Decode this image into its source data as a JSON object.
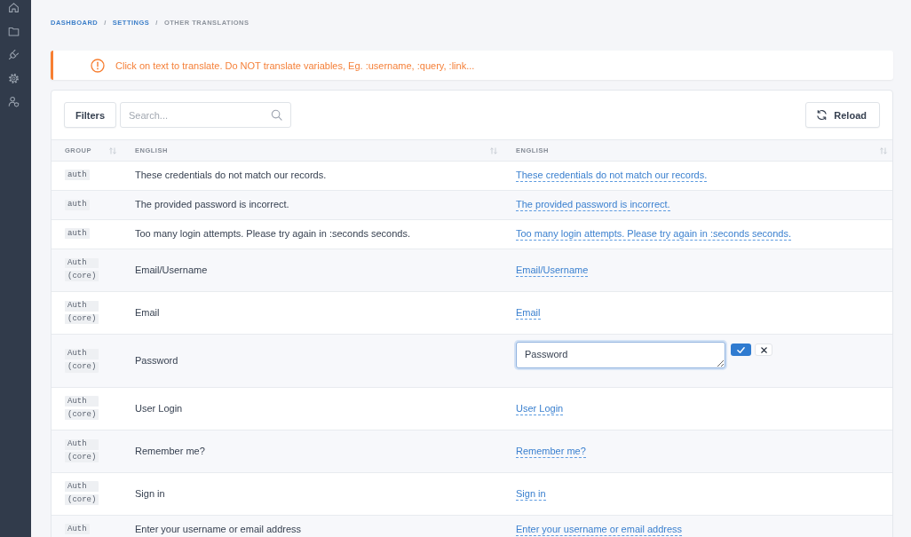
{
  "breadcrumb": [
    {
      "label": "DASHBOARD",
      "kind": "link"
    },
    {
      "label": "/",
      "kind": "separator"
    },
    {
      "label": "SETTINGS",
      "kind": "link"
    },
    {
      "label": "/",
      "kind": "separator"
    },
    {
      "label": "OTHER TRANSLATIONS",
      "kind": "current"
    }
  ],
  "alert": {
    "message": "Click on text to translate. Do NOT translate variables, Eg. :username, :query, :link..."
  },
  "toolbar": {
    "filters_button": "Filters",
    "search": {
      "placeholder": "Search..."
    },
    "reload_button": "Reload"
  },
  "table": {
    "columns": [
      {
        "label": "GROUP"
      },
      {
        "label": "ENGLISH"
      },
      {
        "label": "ENGLISH"
      }
    ],
    "rows": [
      {
        "group": "auth",
        "source": "These credentials do not match our records.",
        "translation": "These credentials do not match our records.",
        "editing": false
      },
      {
        "group": "auth",
        "source": "The provided password is incorrect.",
        "translation": "The provided password is incorrect.",
        "editing": false
      },
      {
        "group": "auth",
        "source": "Too many login attempts. Please try again in :seconds seconds.",
        "translation": "Too many login attempts. Please try again in :seconds seconds.",
        "editing": false
      },
      {
        "group": "Auth (core)",
        "source": "Email/Username",
        "translation": "Email/Username",
        "editing": false
      },
      {
        "group": "Auth (core)",
        "source": "Email",
        "translation": "Email",
        "editing": false
      },
      {
        "group": "Auth (core)",
        "source": "Password",
        "translation": "Password",
        "editing": true
      },
      {
        "group": "Auth (core)",
        "source": "User Login",
        "translation": "User Login",
        "editing": false
      },
      {
        "group": "Auth (core)",
        "source": "Remember me?",
        "translation": "Remember me?",
        "editing": false
      },
      {
        "group": "Auth (core)",
        "source": "Sign in",
        "translation": "Sign in",
        "editing": false
      },
      {
        "group": "Auth",
        "source": "Enter your username or email address",
        "translation": "Enter your username or email address",
        "editing": false
      }
    ]
  }
}
